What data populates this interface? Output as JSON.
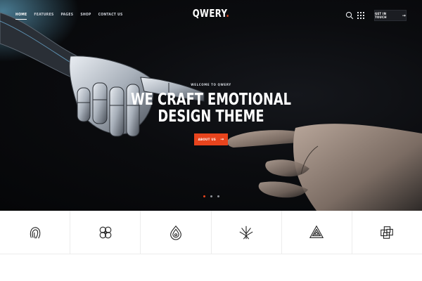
{
  "brand": {
    "name": "QWERY",
    "accent": "#e8441d"
  },
  "nav": {
    "items": [
      {
        "label": "HOME",
        "active": true
      },
      {
        "label": "FEATURES",
        "active": false
      },
      {
        "label": "PAGES",
        "active": false
      },
      {
        "label": "SHOP",
        "active": false
      },
      {
        "label": "CONTACT US",
        "active": false
      }
    ],
    "cta_label": "GET IN TOUCH",
    "icons": [
      "search-icon",
      "grid-menu-icon",
      "arrow-right-icon"
    ]
  },
  "hero": {
    "eyebrow": "WELCOME TO QWERY",
    "headline_line1": "WE CRAFT EMOTIONAL",
    "headline_line2": "DESIGN THEME",
    "button_label": "ABOUT US",
    "slides": {
      "total": 3,
      "active": 1
    }
  },
  "feature_icons": [
    "fingerprint-icon",
    "knot-pattern-icon",
    "drop-rings-icon",
    "radiating-lines-icon",
    "triangle-spiral-icon",
    "interlocked-squares-icon"
  ]
}
